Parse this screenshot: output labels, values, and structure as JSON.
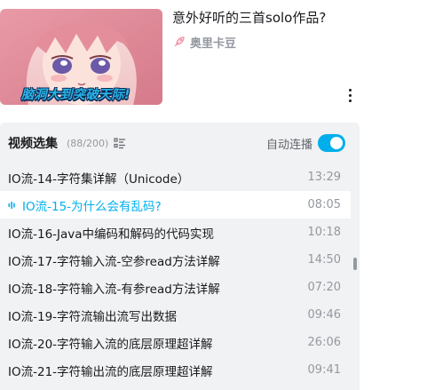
{
  "recommended": {
    "title": "意外好听的三首solo作品?",
    "author": "奥里卡豆",
    "thumbnail_caption": "脑洞大到突破天际!"
  },
  "playlist": {
    "title": "视频选集",
    "count": "(88/200)",
    "autoplay_label": "自动连播",
    "autoplay_on": true,
    "accent_color": "#00aeec",
    "items": [
      {
        "title": "IO流-14-字符集详解（Unicode）",
        "duration": "13:29",
        "active": false
      },
      {
        "title": "IO流-15-为什么会有乱码?",
        "duration": "08:05",
        "active": true
      },
      {
        "title": "IO流-16-Java中编码和解码的代码实现",
        "duration": "10:18",
        "active": false
      },
      {
        "title": "IO流-17-字符输入流-空参read方法详解",
        "duration": "14:50",
        "active": false
      },
      {
        "title": "IO流-18-字符输入流-有参read方法详解",
        "duration": "07:20",
        "active": false
      },
      {
        "title": "IO流-19-字符流输出流写出数据",
        "duration": "09:46",
        "active": false
      },
      {
        "title": "IO流-20-字符输入流的底层原理超详解",
        "duration": "26:06",
        "active": false
      },
      {
        "title": "IO流-21-字符输出流的底层原理超详解",
        "duration": "09:41",
        "active": false
      }
    ]
  }
}
